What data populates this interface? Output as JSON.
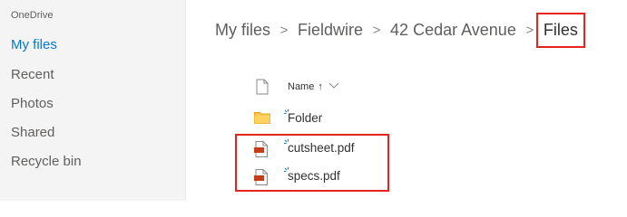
{
  "sidebar": {
    "brand": "OneDrive",
    "items": [
      {
        "label": "My files",
        "active": true
      },
      {
        "label": "Recent"
      },
      {
        "label": "Photos"
      },
      {
        "label": "Shared"
      },
      {
        "label": "Recycle bin"
      }
    ]
  },
  "breadcrumb": {
    "items": [
      "My files",
      "Fieldwire",
      "42 Cedar Avenue",
      "Files"
    ],
    "separator": ">"
  },
  "list": {
    "column_name": "Name",
    "sort_indicator": "↑",
    "files": [
      {
        "name": "Folder",
        "type": "folder"
      },
      {
        "name": "cutsheet.pdf",
        "type": "pdf"
      },
      {
        "name": "specs.pdf",
        "type": "pdf"
      }
    ]
  },
  "colors": {
    "accent": "#0078d4",
    "highlight": "#e8231b",
    "folder": "#f6c44f",
    "pdf": "#c43e1c"
  }
}
